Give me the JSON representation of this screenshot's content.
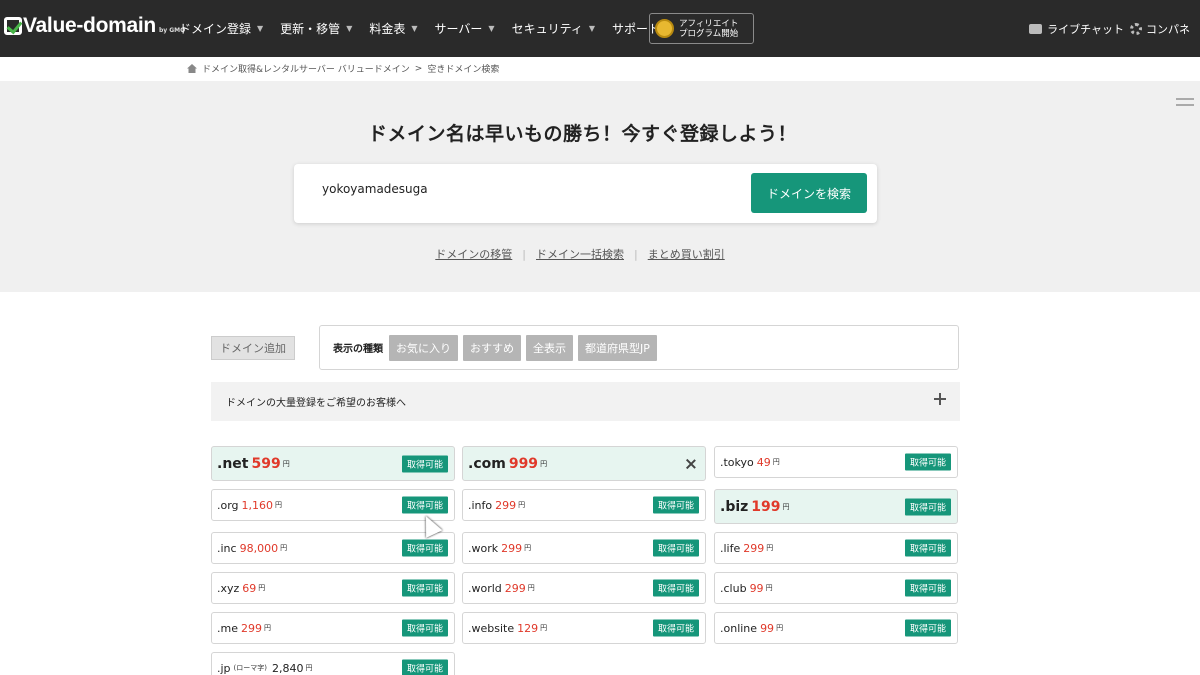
{
  "header": {
    "logo_text": "Value-domain",
    "logo_sub": "by GMO",
    "nav": [
      {
        "label": "ドメイン登録"
      },
      {
        "label": "更新・移管"
      },
      {
        "label": "料金表"
      },
      {
        "label": "サーバー"
      },
      {
        "label": "セキュリティ"
      },
      {
        "label": "サポート"
      }
    ],
    "affiliate_line1": "アフィリエイト",
    "affiliate_line2": "プログラム開始",
    "live_chat": "ライブチャット",
    "control_panel": "コンパネ"
  },
  "breadcrumb": {
    "home": "ドメイン取得&レンタルサーバー バリュードメイン",
    "sep": ">",
    "current": "空きドメイン検索"
  },
  "hero": {
    "title": "ドメイン名は早いもの勝ち！今すぐ登録しよう！",
    "search_value": "yokoyamadesuga",
    "search_button": "ドメインを検索",
    "links": [
      "ドメインの移管",
      "ドメイン一括検索",
      "まとめ買い割引"
    ],
    "link_sep": "|"
  },
  "filters": {
    "add_domain": "ドメイン追加",
    "label": "表示の種類",
    "tags": [
      "お気に入り",
      "おすすめ",
      "全表示",
      "都道府県型JP"
    ]
  },
  "bulk": {
    "label": "ドメインの大量登録をご希望のお客様へ"
  },
  "domains": [
    {
      "tld": ".net",
      "price": "599",
      "yen": "円",
      "status": "取得可能"
    },
    {
      "tld": ".com",
      "price": "999",
      "yen": "円"
    },
    {
      "tld": ".tokyo",
      "price": "49",
      "yen": "円",
      "status": "取得可能"
    },
    {
      "tld": ".org",
      "price": "1,160",
      "yen": "円",
      "status": "取得可能"
    },
    {
      "tld": ".info",
      "price": "299",
      "yen": "円",
      "status": "取得可能"
    },
    {
      "tld": ".biz",
      "price": "199",
      "yen": "円",
      "status": "取得可能"
    },
    {
      "tld": ".inc",
      "price": "98,000",
      "yen": "円",
      "status": "取得可能"
    },
    {
      "tld": ".work",
      "price": "299",
      "yen": "円",
      "status": "取得可能"
    },
    {
      "tld": ".life",
      "price": "299",
      "yen": "円",
      "status": "取得可能"
    },
    {
      "tld": ".xyz",
      "price": "69",
      "yen": "円",
      "status": "取得可能"
    },
    {
      "tld": ".world",
      "price": "299",
      "yen": "円",
      "status": "取得可能"
    },
    {
      "tld": ".club",
      "price": "99",
      "yen": "円",
      "status": "取得可能"
    },
    {
      "tld": ".me",
      "price": "299",
      "yen": "円",
      "status": "取得可能"
    },
    {
      "tld": ".website",
      "price": "129",
      "yen": "円",
      "status": "取得可能"
    },
    {
      "tld": ".online",
      "price": "99",
      "yen": "円",
      "status": "取得可能"
    },
    {
      "tld": ".jp",
      "note": "(ローマ字)",
      "price": "2,840",
      "yen": "円",
      "status": "取得可能"
    }
  ]
}
